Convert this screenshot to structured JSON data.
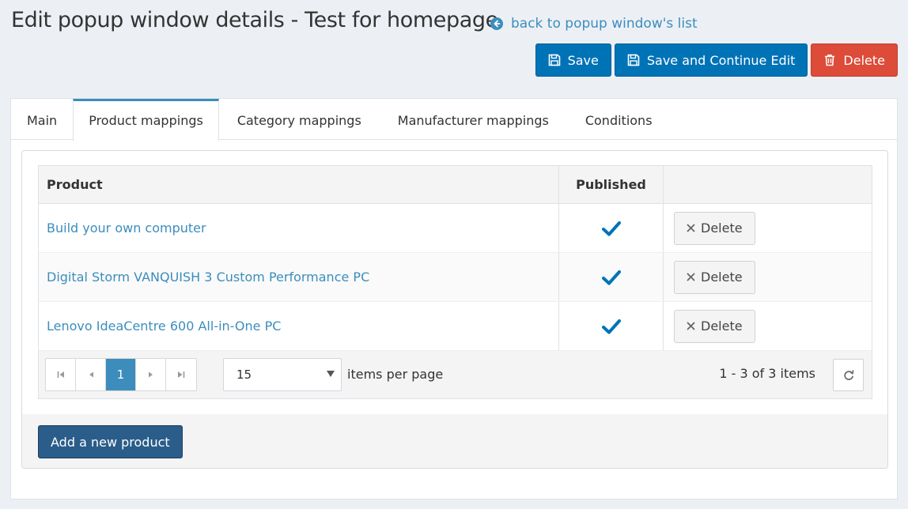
{
  "header": {
    "title": "Edit popup window details - Test for homepage",
    "back_link": "back to popup window's list"
  },
  "toolbar": {
    "save_label": "Save",
    "save_continue_label": "Save and Continue Edit",
    "delete_label": "Delete"
  },
  "tabs": [
    {
      "label": "Main",
      "active": false
    },
    {
      "label": "Product mappings",
      "active": true
    },
    {
      "label": "Category mappings",
      "active": false
    },
    {
      "label": "Manufacturer mappings",
      "active": false
    },
    {
      "label": "Conditions",
      "active": false
    }
  ],
  "grid": {
    "columns": {
      "product": "Product",
      "published": "Published",
      "action": ""
    },
    "rows": [
      {
        "product": "Build your own computer",
        "published": true,
        "action": "Delete"
      },
      {
        "product": "Digital Storm VANQUISH 3 Custom Performance PC",
        "published": true,
        "action": "Delete"
      },
      {
        "product": "Lenovo IdeaCentre 600 All-in-One PC",
        "published": true,
        "action": "Delete"
      }
    ],
    "pager": {
      "current_page": "1",
      "page_size": "15",
      "page_size_label": "items per page",
      "info": "1 - 3 of 3 items"
    }
  },
  "add_button_label": "Add a new product",
  "colors": {
    "primary": "#0073b7",
    "danger": "#dd4b39",
    "link": "#3c8dbc",
    "add_button": "#2a5d89",
    "background": "#ecf0f5"
  }
}
